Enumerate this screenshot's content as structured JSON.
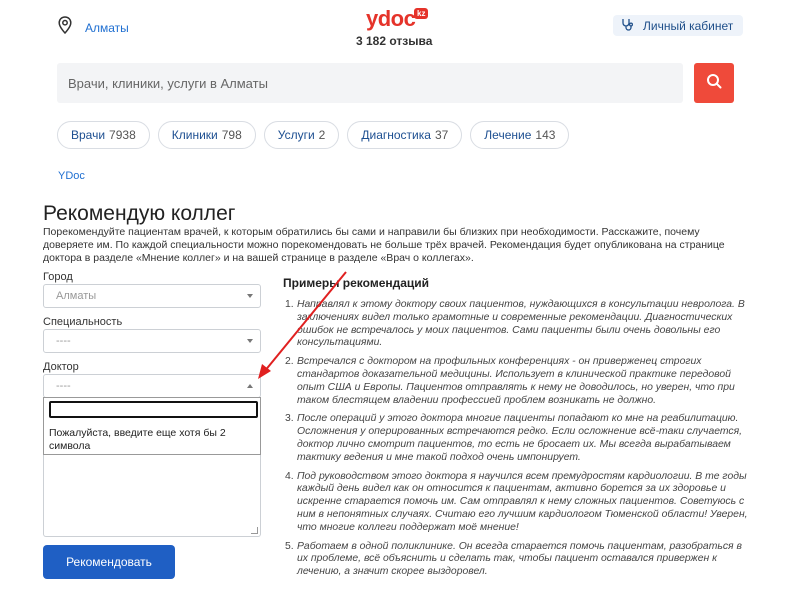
{
  "header": {
    "city": "Алматы",
    "logo": "ydoc",
    "logo_badge": "kz",
    "reviews": "3 182 отзыва",
    "cabinet": "Личный кабинет"
  },
  "search": {
    "placeholder": "Врачи, клиники, услуги в Алматы"
  },
  "chips": [
    {
      "label": "Врачи",
      "count": "7938"
    },
    {
      "label": "Клиники",
      "count": "798"
    },
    {
      "label": "Услуги",
      "count": "2"
    },
    {
      "label": "Диагностика",
      "count": "37"
    },
    {
      "label": "Лечение",
      "count": "143"
    }
  ],
  "breadcrumb": "YDoc",
  "page": {
    "title": "Рекомендую коллег",
    "intro": "Порекомендуйте пациентам врачей, к которым обратились бы сами и направили бы близких при необходимости. Расскажите, почему доверяете им. По каждой специальности можно порекомендовать не больше трёх врачей. Рекомендация будет опубликована на странице доктора в разделе «Мнение коллег» и на вашей странице в разделе «Врач о коллегах»."
  },
  "form": {
    "city_label": "Город",
    "city_value": "Алматы",
    "spec_label": "Специальность",
    "spec_value": "----",
    "doctor_label": "Доктор",
    "doctor_value": "----",
    "dropdown_message": "Пожалуйста, введите еще хотя бы 2 символа",
    "submit": "Рекомендовать"
  },
  "examples": {
    "title": "Примеры рекомендаций",
    "items": [
      {
        "num": "1.",
        "text": "Направлял к этому доктору своих пациентов, нуждающихся в консультации невролога. В заключениях видел только грамотные и современные рекомендации. Диагностических ошибок не встречалось у моих пациентов. Сами пациенты были очень довольны его консультациями."
      },
      {
        "num": "2.",
        "text": "Встречался с доктором на профильных конференциях - он приверженец строгих стандартов доказательной медицины. Использует в клинической практике передовой опыт США и Европы. Пациентов отправлять к нему не доводилось, но уверен, что при таком блестящем владении профессией проблем возникать не должно."
      },
      {
        "num": "3.",
        "text": "После операций у этого доктора многие пациенты попадают ко мне на реабилитацию. Осложнения у оперированных встречаются редко. Если осложнение всё-таки случается, доктор лично смотрит пациентов, то есть не бросает их. Мы всегда вырабатываем тактику ведения и мне такой подход очень импонирует."
      },
      {
        "num": "4.",
        "text": "Под руководством этого доктора я научился всем премудростям кардиологии. В те годы каждый день видел как он относится к пациентам, активно борется за их здоровье и искренне старается помочь им. Сам отправлял к нему сложных пациентов. Советуюсь с ним в непонятных случаях. Считаю его лучшим кардиологом Тюменской области! Уверен, что многие коллеги поддержат моё мнение!"
      },
      {
        "num": "5.",
        "text": "Работаем в одной поликлинике. Он всегда старается помочь пациентам, разобраться в их проблеме, всё объяснить и сделать так, чтобы пациент оставался привержен к лечению, а значит скорее выздоровел."
      }
    ]
  },
  "colors": {
    "brand": "#e5332a",
    "link": "#1f6fd1",
    "primary_button": "#1f5fc4",
    "annotation_arrow": "#e02020"
  }
}
